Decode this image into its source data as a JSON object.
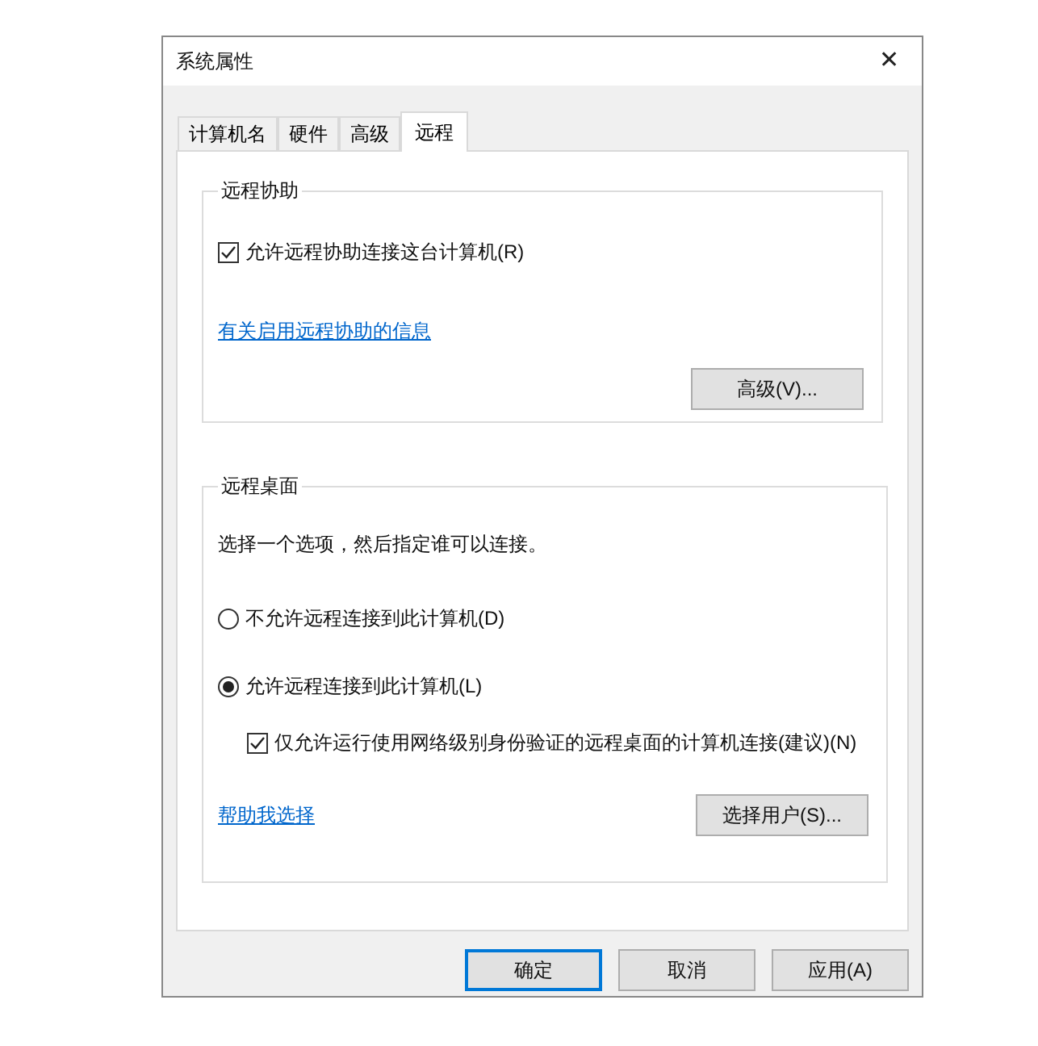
{
  "window": {
    "title": "系统属性",
    "close": "✕"
  },
  "tabs": [
    {
      "label": "计算机名",
      "selected": false
    },
    {
      "label": "硬件",
      "selected": false
    },
    {
      "label": "高级",
      "selected": false
    },
    {
      "label": "远程",
      "selected": true
    }
  ],
  "remote_assistance": {
    "title": "远程协助",
    "checkbox": {
      "label": "允许远程协助连接这台计算机(R)",
      "checked": true
    },
    "link": "有关启用远程协助的信息",
    "button": "高级(V)..."
  },
  "remote_desktop": {
    "title": "远程桌面",
    "description": "选择一个选项，然后指定谁可以连接。",
    "options": [
      {
        "label": "不允许远程连接到此计算机(D)",
        "selected": false
      },
      {
        "label": "允许远程连接到此计算机(L)",
        "selected": true
      }
    ],
    "nla_checkbox": {
      "label": "仅允许运行使用网络级别身份验证的远程桌面的计算机连接(建议)(N)",
      "checked": true
    },
    "link": "帮助我选择",
    "button": "选择用户(S)..."
  },
  "buttons": [
    {
      "label": "确定",
      "kind": "default"
    },
    {
      "label": "取消",
      "kind": "normal"
    },
    {
      "label": "应用(A)",
      "kind": "normal"
    }
  ]
}
